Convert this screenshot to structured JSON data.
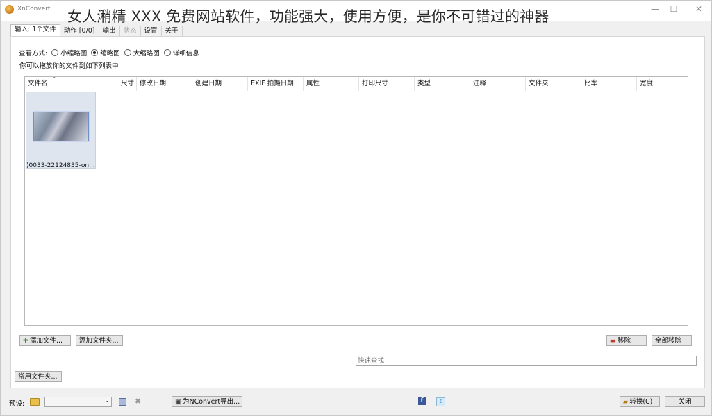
{
  "window": {
    "app_name": "XnConvert",
    "overlay_title": "女人潲精 XXX 免费网站软件，功能强大，使用方便，是你不可错过的神器",
    "min_icon": "—",
    "max_icon": "☐",
    "close_icon": "✕"
  },
  "tabs": [
    {
      "label": "输入: 1个文件"
    },
    {
      "label": "动作 [0/0]"
    },
    {
      "label": "输出"
    },
    {
      "label": "状态"
    },
    {
      "label": "设置"
    },
    {
      "label": "关于"
    }
  ],
  "view": {
    "label": "查看方式:",
    "options": [
      "小缩略图",
      "缩略图",
      "大缩略图",
      "详细信息"
    ],
    "selected": "缩略图",
    "drag_hint": "你可以拖放你的文件到如下列表中"
  },
  "columns": [
    "文件名",
    "尺寸",
    "修改日期",
    "创建日期",
    "EXIF 拍摄日期",
    "属性",
    "打印尺寸",
    "类型",
    "注释",
    "文件夹",
    "比率",
    "宽度"
  ],
  "files": [
    {
      "caption": ")0033-22124835-on..."
    }
  ],
  "buttons": {
    "add_files": "添加文件...",
    "add_folder": "添加文件夹...",
    "remove": "移除",
    "remove_all": "全部移除",
    "common_folders": "常用文件夹...",
    "export": "为NConvert导出...",
    "convert": "转换(C)",
    "close": "关闭"
  },
  "search": {
    "placeholder": "快速查找"
  },
  "bottom": {
    "preset_label": "预设:",
    "preset_value": ""
  },
  "colors": {
    "accent_blue": "#3b5998",
    "folder_yellow": "#e8c04a"
  }
}
